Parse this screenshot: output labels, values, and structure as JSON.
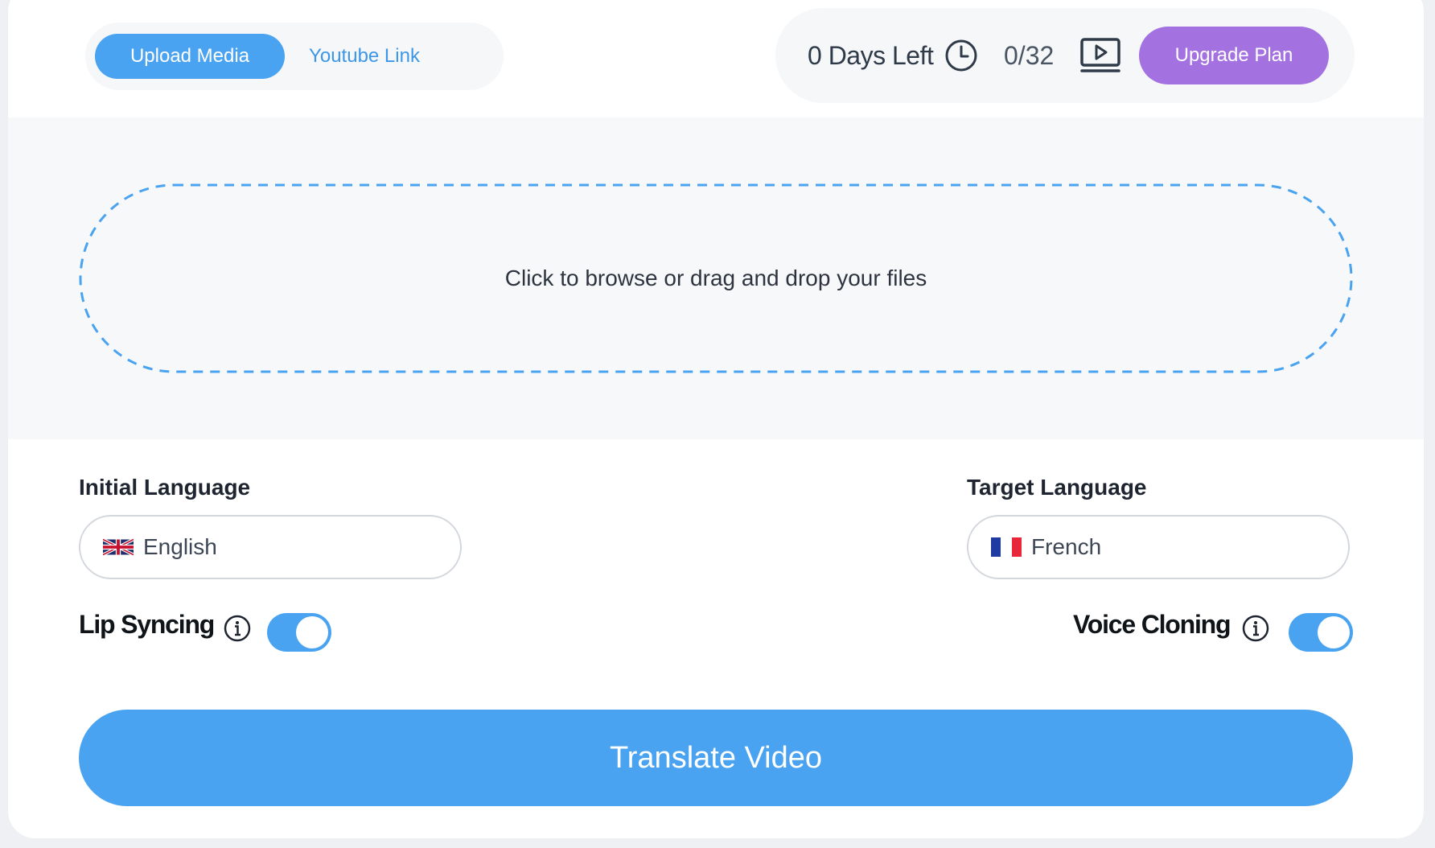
{
  "tabs": {
    "upload_label": "Upload Media",
    "youtube_label": "Youtube Link"
  },
  "status": {
    "days_left": "0 Days Left",
    "video_count": "0/32",
    "upgrade_label": "Upgrade Plan"
  },
  "dropzone": {
    "text": "Click to browse or drag and drop your files"
  },
  "languages": {
    "initial_label": "Initial Language",
    "initial_value": "English",
    "initial_flag": "uk-flag-icon",
    "target_label": "Target Language",
    "target_value": "French",
    "target_flag": "france-flag-icon"
  },
  "options": {
    "lip_syncing_label": "Lip Syncing",
    "lip_syncing_on": true,
    "voice_cloning_label": "Voice Cloning",
    "voice_cloning_on": true
  },
  "actions": {
    "translate_label": "Translate Video"
  },
  "colors": {
    "accent": "#4aa3f0",
    "upgrade": "#a472e0",
    "dropzone_border": "#4aa3f0"
  }
}
